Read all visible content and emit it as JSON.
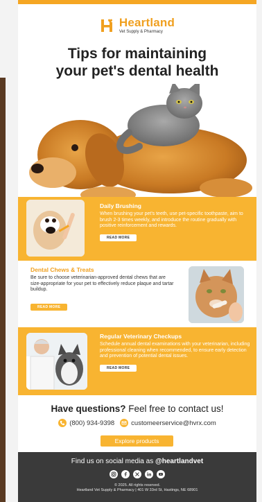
{
  "logo": {
    "name": "Heartland",
    "tagline": "Vet Supply & Pharmacy"
  },
  "headline": {
    "line1": "Tips for maintaining",
    "line2": "your pet's dental health"
  },
  "sections": [
    {
      "title": "Daily Brushing",
      "body": "When brushing your pet's teeth, use pet-specific toothpaste, aim to brush 2-3 times weekly, and introduce the routine gradually with positive reinforcement and rewards.",
      "button": "READ MORE"
    },
    {
      "title": "Dental Chews & Treats",
      "body": "Be sure to choose veterinarian-approved dental chews that are size-appropriate for your pet to effectively reduce plaque and tartar buildup.",
      "button": "READ MORE"
    },
    {
      "title": "Regular Veterinary Checkups",
      "body": "Schedule annual dental examinations with your veterinarian, including professional cleaning when recommended, to ensure early detection and prevention of potential dental issues.",
      "button": "READ MORE"
    }
  ],
  "contact": {
    "title_bold": "Have questions?",
    "title_rest": " Feel free to contact us!",
    "phone": "(800) 934-9398",
    "email": "customeerservice@hvrx.com",
    "button": "Explore products"
  },
  "footer": {
    "social_prefix": "Find us on social media as ",
    "handle": "@heartlandvet",
    "socials": [
      "instagram-icon",
      "facebook-icon",
      "x-icon",
      "linkedin-icon",
      "youtube-icon"
    ],
    "copyright": "© 2025. All rights reserved.",
    "address": "Heartland Vet Supply & Pharmacy | 401 W 33rd St, Hastings, NE 68901"
  },
  "colors": {
    "accent": "#f8b431",
    "brand": "#f0a020",
    "footer": "#3a3a3a"
  }
}
